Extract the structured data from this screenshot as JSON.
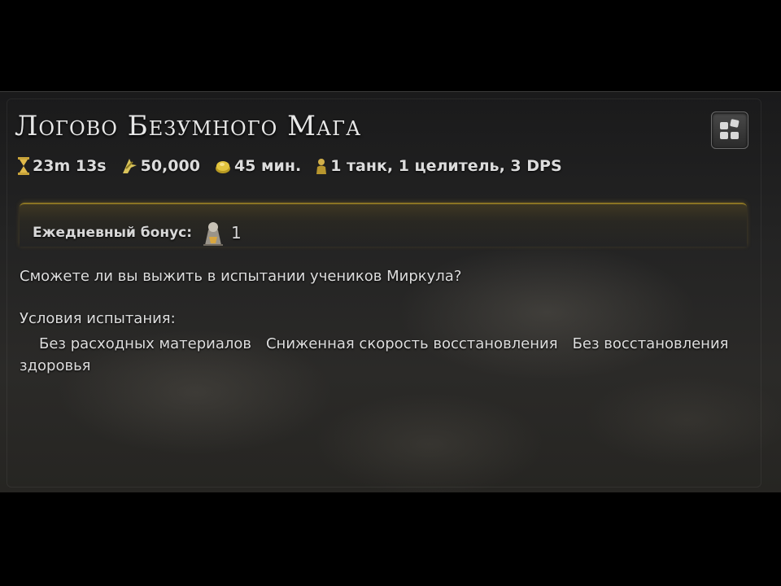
{
  "dungeon": {
    "title": "Логово Безумного Мага"
  },
  "stats": {
    "time": "23m 13s",
    "xp": "50,000",
    "duration": "45 мин.",
    "party": "1 танк, 1 целитель, 3 DPS"
  },
  "bonus": {
    "label": "Ежедневный бонус:",
    "count": "1"
  },
  "description": "Сможете ли вы выжить в испытании учеников Миркула?",
  "conditions": {
    "title": "Условия испытания:",
    "items": [
      "Без расходных материалов",
      "Сниженная скорость восстановления",
      "Без восстановления здоровья"
    ]
  },
  "colors": {
    "accent_gold": "#8a7424",
    "text": "#dedede"
  },
  "icons": {
    "menu": "grid-menu-icon",
    "time": "hourglass-icon",
    "xp": "experience-icon",
    "duration": "coin-icon",
    "party": "person-icon",
    "bonus": "seal-icon"
  }
}
